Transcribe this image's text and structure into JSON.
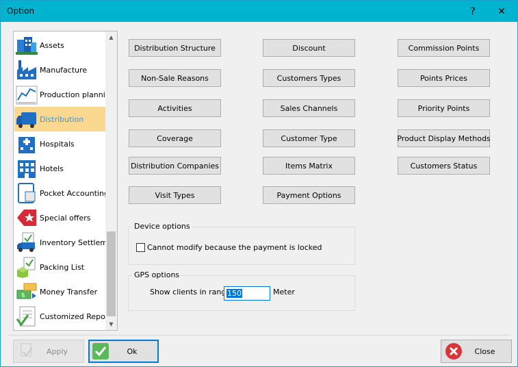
{
  "window": {
    "title": "Option",
    "help": "?",
    "close": "✕"
  },
  "sidebar": {
    "items": [
      {
        "label": "Assets"
      },
      {
        "label": "Manufacture"
      },
      {
        "label": "Production planning"
      },
      {
        "label": "Distribution",
        "selected": true
      },
      {
        "label": "Hospitals"
      },
      {
        "label": "Hotels"
      },
      {
        "label": "Pocket Accounting"
      },
      {
        "label": "Special offers"
      },
      {
        "label": "Inventory Settlement"
      },
      {
        "label": "Packing List"
      },
      {
        "label": "Money Transfer"
      },
      {
        "label": "Customized Reports"
      }
    ],
    "scroll_up": "▲",
    "scroll_down": "▼"
  },
  "buttons": {
    "col1": [
      "Distribution Structure",
      "Non-Sale Reasons",
      "Activities",
      "Coverage",
      "Distribution Companies",
      "Visit Types"
    ],
    "col2": [
      "Discount",
      "Customers Types",
      "Sales Channels",
      "Customer Type",
      "Items Matrix",
      "Payment Options"
    ],
    "col3": [
      "Commission Points",
      "Points Prices",
      "Priority Points",
      "Product Display Methods",
      "Customers Status"
    ]
  },
  "device_options": {
    "title": "Device options",
    "lock_label": "Cannot modify because the payment is locked",
    "lock_checked": false
  },
  "gps_options": {
    "title": "GPS options",
    "range_label": "Show clients in range",
    "range_value": "150",
    "unit": "Meter"
  },
  "footer": {
    "apply": "Apply",
    "ok": "Ok",
    "close": "Close"
  }
}
